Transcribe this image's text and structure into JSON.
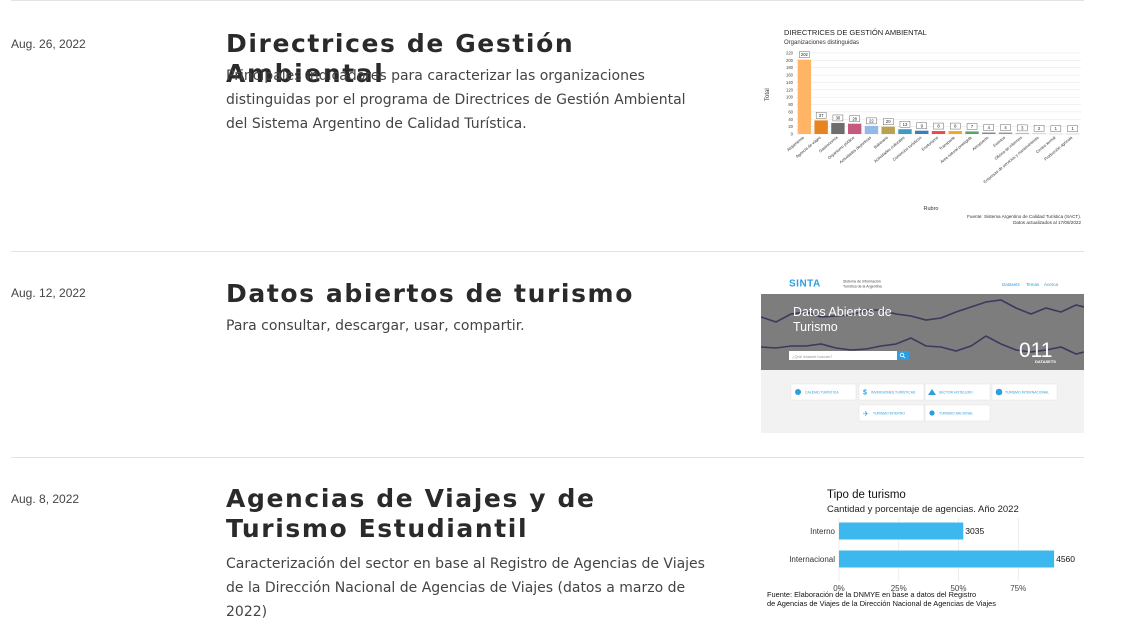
{
  "posts": [
    {
      "date": "Aug. 26, 2022",
      "title": "Directrices de Gestión Ambiental",
      "excerpt": "Principales indicadores para caracterizar las organizaciones distinguidas por el programa de Directrices de Gestión Ambiental del Sistema Argentino de Calidad Turística.",
      "thumb": {
        "title": "DIRECTRICES DE GESTIÓN AMBIENTAL",
        "subtitle": "Organizaciones distinguidas",
        "ylabel": "Total",
        "xlabel": "Rubro",
        "source": "Fuente: Sistema Argentino de Calidad Turística (SACT).",
        "updated": "Datos actualizados al 17/08/2022"
      }
    },
    {
      "date": "Aug. 12, 2022",
      "title": "Datos abiertos de turismo",
      "excerpt": "Para consultar, descargar, usar, compartir.",
      "thumb": {
        "brand": "SINTA",
        "brand_sub1": "Sistema de Información",
        "brand_sub2": "Turística de la Argentina",
        "nav": [
          "Datasets",
          "Temas",
          "Acerca"
        ],
        "hero_title_1": "Datos Abiertos de",
        "hero_title_2": "Turismo",
        "search_placeholder": "¿Qué dataset buscás?",
        "count": "011",
        "count_label": "DATASETS",
        "categories": [
          "CALIDAD TURÍSTICA",
          "INVERSIONES TURÍSTICAS",
          "SECTOR HOTELERO",
          "TURISMO INTERNACIONAL",
          "TURISMO INTERNO",
          "TURISMO NACIONAL"
        ]
      }
    },
    {
      "date": "Aug. 8, 2022",
      "title": "Agencias de Viajes y de Turismo Estudiantil",
      "excerpt": "Caracterización del sector en base al Registro de Agencias de Viajes de la Dirección Nacional de Agencias de Viajes (datos a marzo de 2022)",
      "thumb": {
        "title": "Tipo de turismo",
        "subtitle": "Cantidad y porcentaje de agencias. Año 2022",
        "source_1": "Fuente: Elaboración de la DNMYE en base a datos del Registro",
        "source_2": "de Agencias de Viajes de la Dirección Nacional de Agencias de Viajes"
      }
    }
  ],
  "chart_data": [
    {
      "type": "bar",
      "title": "DIRECTRICES DE GESTIÓN AMBIENTAL",
      "subtitle": "Organizaciones distinguidas",
      "xlabel": "Rubro",
      "ylabel": "Total",
      "ylim": [
        0,
        220
      ],
      "yticks": [
        0,
        20,
        40,
        60,
        80,
        100,
        120,
        140,
        160,
        180,
        200,
        220
      ],
      "categories": [
        "Alojamiento",
        "Agencia de viajes",
        "Gastronomía",
        "Organismo público",
        "Actividades deportivas",
        "Balneario",
        "Actividades culturales",
        "Comercios turísticos",
        "Enoturismo",
        "Transporte",
        "Área natural protegida",
        "Aeropuerto",
        "Eventos",
        "Oficina de informes",
        "Empresas de servicios y mantenimiento",
        "Centro termal",
        "Producción agrícola"
      ],
      "values": [
        202,
        37,
        30,
        28,
        22,
        20,
        13,
        9,
        8,
        8,
        7,
        4,
        4,
        3,
        2,
        1,
        1
      ],
      "colors": [
        "#ffb565",
        "#e8841e",
        "#6e6e6e",
        "#c55a7c",
        "#93b9e6",
        "#b8a14f",
        "#3e9bc6",
        "#3a7fb8",
        "#e94b4b",
        "#f5a623",
        "#5aa469",
        "#8a8a8a",
        "#999999",
        "#bbbbbb",
        "#cccccc",
        "#cccccc",
        "#cccccc"
      ],
      "grid": true
    },
    {
      "type": "bar",
      "orientation": "horizontal",
      "title": "Tipo de turismo",
      "subtitle": "Cantidad y porcentaje de agencias. Año 2022",
      "categories": [
        "Interno",
        "Internacional"
      ],
      "values": [
        3035,
        4560
      ],
      "percent": [
        52,
        90
      ],
      "xticks": [
        "0%",
        "25%",
        "50%",
        "75%"
      ],
      "xlim": [
        0,
        100
      ],
      "color": "#3db8ee"
    }
  ]
}
